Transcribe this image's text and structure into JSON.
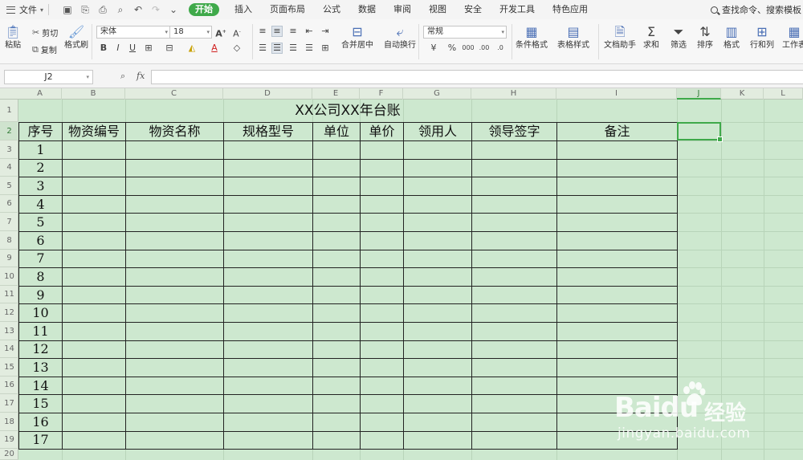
{
  "menubar": {
    "file_label": "文件",
    "tabs": [
      "开始",
      "插入",
      "页面布局",
      "公式",
      "数据",
      "审阅",
      "视图",
      "安全",
      "开发工具",
      "特色应用"
    ],
    "active_tab": "开始",
    "search_label": "查找命令、搜索模板"
  },
  "ribbon": {
    "paste": "粘贴",
    "cut": "剪切",
    "copy": "复制",
    "format_painter": "格式刷",
    "font_name": "宋体",
    "font_size": "18",
    "merge_center": "合并居中",
    "wrap_text": "自动换行",
    "number_format": "常规",
    "conditional_format": "条件格式",
    "table_style": "表格样式",
    "doc_assistant": "文档助手",
    "sum": "求和",
    "filter": "筛选",
    "sort": "排序",
    "format": "格式",
    "row_col": "行和列",
    "worksheet": "工作表"
  },
  "formula_bar": {
    "name_box": "J2",
    "fx_label": "fx",
    "value": ""
  },
  "columns": [
    "A",
    "B",
    "C",
    "D",
    "E",
    "F",
    "G",
    "H",
    "I",
    "J",
    "K",
    "L"
  ],
  "selected_column": "J",
  "rows": [
    "1",
    "2",
    "3",
    "4",
    "5",
    "6",
    "7",
    "8",
    "9",
    "10",
    "11",
    "12",
    "13",
    "14",
    "15",
    "16",
    "17",
    "18",
    "19",
    "20"
  ],
  "selected_row": "2",
  "sheet": {
    "title": "XX公司XX年台账",
    "headers": [
      "序号",
      "物资编号",
      "物资名称",
      "规格型号",
      "单位",
      "单价",
      "领用人",
      "领导签字",
      "备注"
    ],
    "serials": [
      "1",
      "2",
      "3",
      "4",
      "5",
      "6",
      "7",
      "8",
      "9",
      "10",
      "11",
      "12",
      "13",
      "14",
      "15",
      "16",
      "17"
    ]
  },
  "watermark": {
    "brand": "Baidu",
    "brand_cn": "经验",
    "url": "jingyan.baidu.com"
  }
}
